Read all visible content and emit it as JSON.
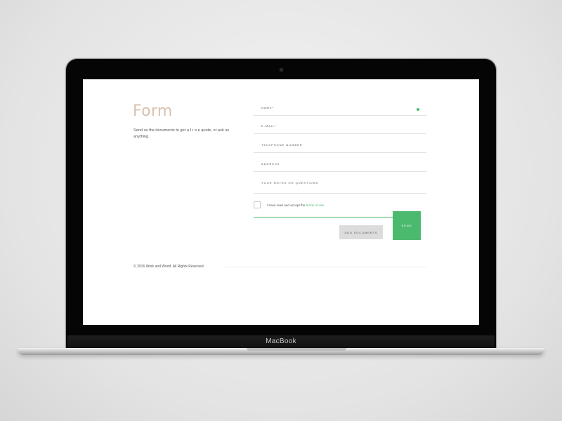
{
  "device": {
    "brand_label": "MacBook"
  },
  "page": {
    "title": "Form",
    "subtitle": "Send us the documents to get a f r e e quote, or ask us anything."
  },
  "form": {
    "fields": [
      {
        "label": "NAME*",
        "required_indicator_color": "#4cba6e"
      },
      {
        "label": "E-MAIL*"
      },
      {
        "label": "TELEPHONE NUMBER"
      },
      {
        "label": "ADDRESS"
      },
      {
        "label": "YOUR NOTES OR QUESTIONS"
      }
    ],
    "agree_text": "I have read and accept the",
    "terms_link": "terms of use.",
    "add_documents_label": "ADD DOCUMENTS",
    "send_label": "SEND"
  },
  "footer": {
    "copyright": "© 2016 Work and Wood. All Rights Reserved."
  },
  "colors": {
    "accent": "#4cba6e",
    "title": "#d9c1ad",
    "button_secondary": "#dcdcdc"
  }
}
